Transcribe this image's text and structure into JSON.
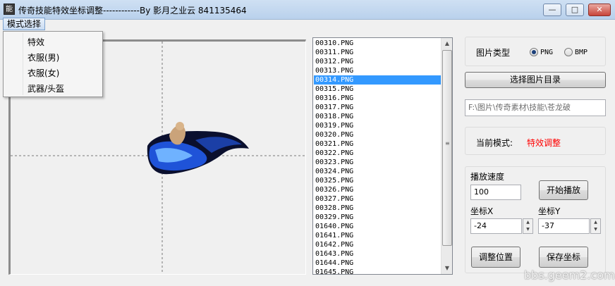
{
  "window": {
    "title": "传奇技能特效坐标调整------------By 影月之业云 841135464",
    "icon_glyph": "能",
    "controls": {
      "minimize": "—",
      "maximize": "□",
      "close": "✕"
    }
  },
  "menubar": {
    "mode_menu_label": "模式选择",
    "dropdown_items": [
      "特效",
      "衣服(男)",
      "衣服(女)",
      "武器/头盔"
    ]
  },
  "file_list": {
    "items": [
      "00310.PNG",
      "00311.PNG",
      "00312.PNG",
      "00313.PNG",
      "00314.PNG",
      "00315.PNG",
      "00316.PNG",
      "00317.PNG",
      "00318.PNG",
      "00319.PNG",
      "00320.PNG",
      "00321.PNG",
      "00322.PNG",
      "00323.PNG",
      "00324.PNG",
      "00325.PNG",
      "00326.PNG",
      "00327.PNG",
      "00328.PNG",
      "00329.PNG",
      "01640.PNG",
      "01641.PNG",
      "01642.PNG",
      "01643.PNG",
      "01644.PNG",
      "01645.PNG"
    ],
    "selected": "00314.PNG"
  },
  "image_type": {
    "label": "图片类型",
    "options": [
      "PNG",
      "BMP"
    ],
    "selected": "PNG"
  },
  "select_dir_button": "选择图片目录",
  "path_field": "F:\\图片\\传奇素材\\技能\\苍龙破",
  "current_mode": {
    "label": "当前模式:",
    "value": "特效调整",
    "value_color": "#ff0000"
  },
  "playback": {
    "speed_label": "播放速度",
    "speed_value": "100",
    "start_button": "开始播放",
    "coord_x_label": "坐标X",
    "coord_x_value": "-24",
    "coord_y_label": "坐标Y",
    "coord_y_value": "-37",
    "adjust_button": "调整位置",
    "save_button": "保存坐标"
  },
  "watermark": "bbs.geem2.com",
  "colors": {
    "selection": "#3399ff",
    "titlebar": "#b9d1ec",
    "effect_blue": "#2f6cff"
  }
}
